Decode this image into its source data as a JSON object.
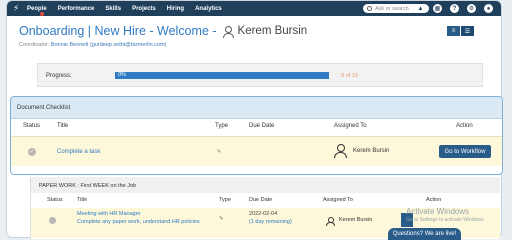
{
  "nav": {
    "items": [
      "People",
      "Performance",
      "Skills",
      "Projects",
      "Hiring",
      "Analytics"
    ],
    "search_placeholder": "Ask or search"
  },
  "header": {
    "title": "Onboarding | New Hire - Welcome -",
    "user_name": "Kerem Bursin",
    "coordinator_label": "Coordinator:",
    "coordinator_name": "Bonnie Bennett (gurdeep.sethi@bizmerlin.com)"
  },
  "progress": {
    "label": "Progress:",
    "percent_text": "0%",
    "count_text": "0 of 19",
    "value": 0
  },
  "checklist": {
    "heading": "Document Checklist",
    "columns": {
      "status": "Status",
      "title": "Title",
      "type": "Type",
      "due": "Due Date",
      "assigned": "Assigned To",
      "action": "Action"
    },
    "row": {
      "title": "Complete a task",
      "type_icon": "pen-icon",
      "assignee": "Kerem Bursin",
      "action_label": "Go to Workflow"
    }
  },
  "paperwork": {
    "heading": "PAPER WORK : First WEEK on the Job",
    "columns": {
      "status": "Status",
      "title": "Title",
      "type": "Type",
      "due": "Due Date",
      "assigned": "Assigned To",
      "action": "Action"
    },
    "row": {
      "title": "Meeting with HR Manager",
      "description": "Complete any paper work, understand HR policies",
      "due": "2022-02-04",
      "due_sub": "(1 day remaining)",
      "assignee": "Kerem Bursin"
    }
  },
  "watermark": {
    "line1": "Activate Windows",
    "line2": "Go to Settings to activate Windows."
  },
  "chat": {
    "label": "Questions? We are live!"
  }
}
